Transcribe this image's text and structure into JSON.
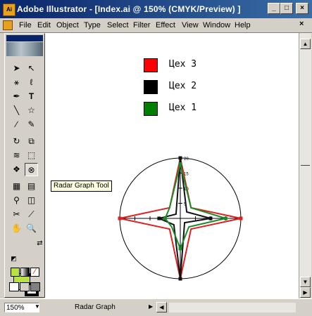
{
  "window": {
    "app_icon": "Ai",
    "title": "Adobe Illustrator - [Index.ai @ 150% (CMYK/Preview) ]",
    "buttons": {
      "minimize": "_",
      "maximize": "□",
      "close": "×"
    }
  },
  "menu": [
    "File",
    "Edit",
    "Object",
    "Type",
    "Select",
    "Filter",
    "Effect",
    "View",
    "Window",
    "Help"
  ],
  "tools": {
    "icons": [
      "selection-tool-icon",
      "direct-selection-tool-icon",
      "magic-wand-tool-icon",
      "lasso-tool-icon",
      "pen-tool-icon",
      "type-tool-icon",
      "line-segment-tool-icon",
      "star-tool-icon",
      "paintbrush-tool-icon",
      "pencil-tool-icon",
      "rotate-tool-icon",
      "scale-tool-icon",
      "warp-tool-icon",
      "free-transform-tool-icon",
      "symbol-sprayer-tool-icon",
      "radar-graph-tool-icon",
      "mesh-tool-icon",
      "gradient-tool-icon",
      "eyedropper-tool-icon",
      "blend-tool-icon",
      "scissors-tool-icon",
      "slice-tool-icon",
      "hand-tool-icon",
      "zoom-tool-icon"
    ],
    "tooltip": "Radar Graph Tool"
  },
  "colors": {
    "fill": "#b9e045",
    "stroke": "#000000"
  },
  "legend": [
    {
      "label": "Цех 3",
      "color": "#ff0000"
    },
    {
      "label": "Цех 2",
      "color": "#000000"
    },
    {
      "label": "Цех 1",
      "color": "#008000"
    }
  ],
  "chart_data": {
    "type": "radar",
    "axis_ticks": [
      5,
      10,
      15,
      20
    ],
    "rmax": 20,
    "series": [
      {
        "name": "Цех 3",
        "color": "#e02020",
        "values": [
          20,
          5,
          20,
          5,
          20,
          5,
          20,
          5
        ]
      },
      {
        "name": "Цех 2",
        "color": "#111111",
        "values": [
          20,
          3,
          10,
          2,
          20,
          3,
          7,
          2
        ]
      },
      {
        "name": "Цех 1",
        "color": "#1a8a2a",
        "values": [
          18,
          5,
          15,
          4,
          10,
          4,
          5,
          5
        ]
      }
    ]
  },
  "status": {
    "zoom": "150%",
    "tool_name": "Radar Graph"
  }
}
